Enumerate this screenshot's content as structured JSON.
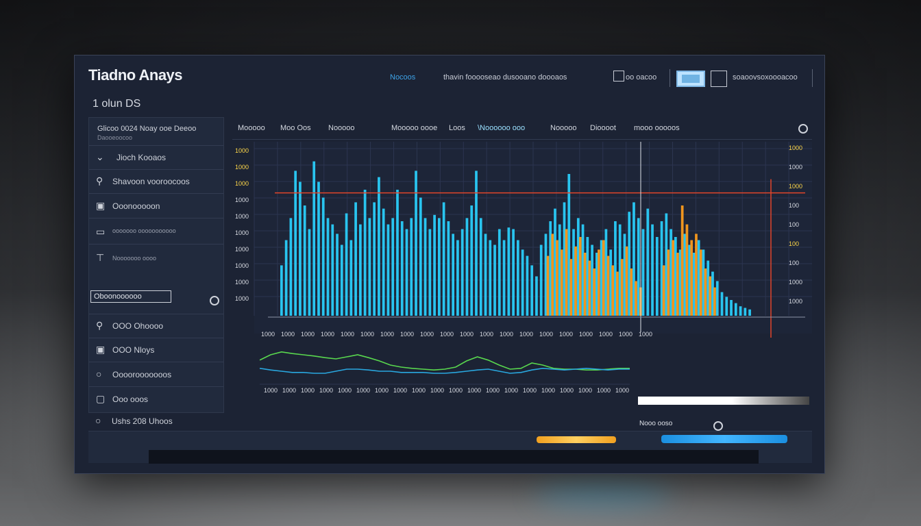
{
  "app": {
    "title": "Tiadno Anays",
    "subtitle": "1 olun  DS"
  },
  "header": {
    "link": "Nocoos",
    "text": "thavin fooooseao dusooano doooaos",
    "mode": "oo oacoo",
    "user": "soaoovsoxoooacoo"
  },
  "sidebar": {
    "top_text": "Glicoo  0024  Noay  ooe  Deeoo",
    "top_subtext": "Daooeoocoo",
    "header_item": "Jioch  Kooaos",
    "items": [
      {
        "icon": "pin-icon",
        "label": "Shavoon  vooroocoos"
      },
      {
        "icon": "camera-icon",
        "label": "Ooonooooon"
      },
      {
        "icon": "battery-icon",
        "label": "ooooooo  ooooooooooo"
      },
      {
        "icon": "slider-icon",
        "label": "Nooooooo  oooo"
      },
      {
        "icon": "pin-icon",
        "label": "OOO  Ohoooo"
      },
      {
        "icon": "camera-icon",
        "label": "OOO  Nloys"
      },
      {
        "icon": "circle-icon",
        "label": "Oooorooooooos"
      },
      {
        "icon": "square-icon",
        "label": "Ooo  ooos"
      },
      {
        "icon": "circle-icon",
        "label": "Ushs 208 Uhoos"
      }
    ],
    "selected_box": "Oboonoooooo"
  },
  "tabs": [
    "Mooooo",
    "Moo  Oos",
    "Nooooo",
    "Mooooo  oooe",
    "Loos",
    "\\Noooooo  ooo",
    "Nooooo",
    "Dioooot",
    "mooo  ooooos"
  ],
  "right_panel": {
    "label": "Nooo  ooso"
  },
  "chart_data": {
    "type": "bar",
    "ylabel": "",
    "xlabel": "",
    "y_ticks": [
      "1000",
      "1000",
      "1000",
      "1000",
      "1000",
      "1000",
      "1000",
      "1000",
      "1000",
      "1000"
    ],
    "right_y_ticks": [
      "1000",
      "1000",
      "1000",
      "100",
      "100",
      "100",
      "100",
      "1000",
      "1000"
    ],
    "x_ticks": [
      "1000",
      "1000",
      "1000",
      "1000",
      "1000",
      "1000",
      "1000",
      "1000",
      "1000",
      "1000",
      "1000",
      "1000",
      "1000",
      "1000",
      "1000",
      "1000",
      "1000",
      "1000",
      "1000",
      "1000"
    ],
    "threshold": 0.78,
    "series": [
      {
        "color": "#29c4ef",
        "values": [
          0.32,
          0.48,
          0.62,
          0.92,
          0.85,
          0.7,
          0.55,
          0.98,
          0.85,
          0.75,
          0.62,
          0.58,
          0.52,
          0.45,
          0.65,
          0.48,
          0.72,
          0.58,
          0.8,
          0.62,
          0.72,
          0.88,
          0.68,
          0.58,
          0.62,
          0.8,
          0.6,
          0.55,
          0.62,
          0.92,
          0.75,
          0.62,
          0.55,
          0.64,
          0.62,
          0.72,
          0.6,
          0.52,
          0.48,
          0.55,
          0.62,
          0.7,
          0.92,
          0.62,
          0.52,
          0.48,
          0.45,
          0.55,
          0.48,
          0.56,
          0.55,
          0.48,
          0.42,
          0.38,
          0.32,
          0.25,
          0.45,
          0.52,
          0.6,
          0.68,
          0.58,
          0.72,
          0.9,
          0.55,
          0.62,
          0.58,
          0.5,
          0.45,
          0.4,
          0.48,
          0.55,
          0.42,
          0.6,
          0.58,
          0.52,
          0.66,
          0.72,
          0.62,
          0.55,
          0.68,
          0.58,
          0.5,
          0.6,
          0.65,
          0.55,
          0.5,
          0.42,
          0.52,
          0.45,
          0.4,
          0.48,
          0.42,
          0.35,
          0.28,
          0.22,
          0.15,
          0.12,
          0.1,
          0.08,
          0.06,
          0.05,
          0.04
        ]
      },
      {
        "color": "#f0951e",
        "values": [
          0,
          0,
          0,
          0,
          0,
          0,
          0,
          0,
          0,
          0,
          0,
          0,
          0,
          0,
          0,
          0,
          0,
          0,
          0,
          0,
          0,
          0,
          0,
          0,
          0,
          0,
          0,
          0,
          0,
          0,
          0,
          0,
          0,
          0,
          0,
          0,
          0,
          0,
          0,
          0,
          0,
          0,
          0,
          0,
          0,
          0,
          0,
          0,
          0,
          0,
          0,
          0,
          0,
          0,
          0,
          0,
          0,
          0.38,
          0.52,
          0.48,
          0.42,
          0.55,
          0.36,
          0.44,
          0.5,
          0.4,
          0.35,
          0.3,
          0.42,
          0.48,
          0.38,
          0.32,
          0.28,
          0.36,
          0.44,
          0.3,
          0.22,
          0.18,
          0,
          0,
          0,
          0,
          0.32,
          0.42,
          0.48,
          0.4,
          0.7,
          0.58,
          0.48,
          0.52,
          0.42,
          0.3,
          0.25,
          0.18,
          0,
          0,
          0,
          0,
          0,
          0,
          0,
          0
        ]
      }
    ],
    "line_series": [
      {
        "color": "#59d84e",
        "values": [
          0.42,
          0.55,
          0.62,
          0.58,
          0.55,
          0.52,
          0.48,
          0.45,
          0.5,
          0.55,
          0.48,
          0.4,
          0.3,
          0.25,
          0.22,
          0.2,
          0.18,
          0.2,
          0.25,
          0.4,
          0.5,
          0.42,
          0.3,
          0.2,
          0.22,
          0.35,
          0.3,
          0.22,
          0.2,
          0.2,
          0.18,
          0.18,
          0.2,
          0.22,
          0.22
        ]
      },
      {
        "color": "#29a8e0",
        "values": [
          0.22,
          0.18,
          0.15,
          0.12,
          0.12,
          0.1,
          0.1,
          0.15,
          0.2,
          0.2,
          0.18,
          0.15,
          0.15,
          0.12,
          0.12,
          0.12,
          0.1,
          0.1,
          0.12,
          0.15,
          0.18,
          0.2,
          0.15,
          0.1,
          0.12,
          0.18,
          0.22,
          0.2,
          0.18,
          0.2,
          0.22,
          0.2,
          0.18,
          0.2,
          0.2
        ]
      }
    ]
  }
}
